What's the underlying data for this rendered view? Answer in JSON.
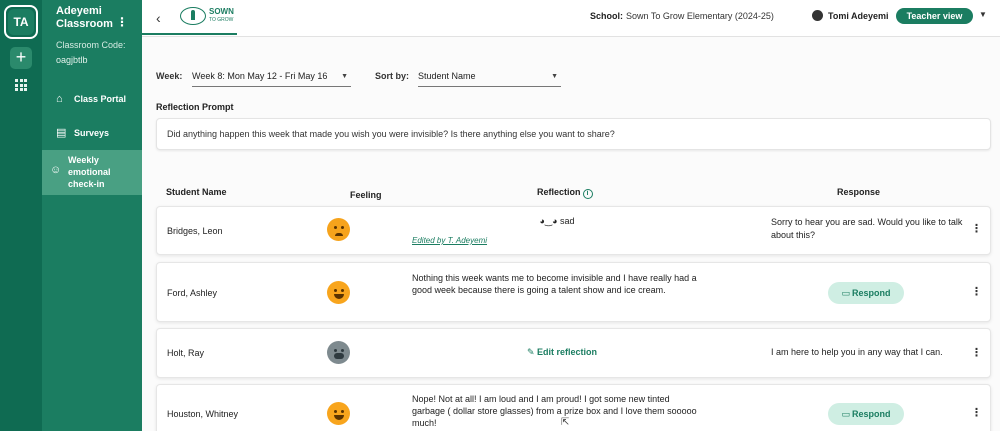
{
  "sidebar": {
    "avatar_initials": "TA",
    "add_symbol": "+",
    "classroom_name": "Adeyemi Classroom",
    "code_label": "Classroom Code:",
    "code_value": "oagjbtlb",
    "items": [
      {
        "label": "Class Portal",
        "icon": "home-icon"
      },
      {
        "label": "Surveys",
        "icon": "clipboard-icon"
      },
      {
        "label": "Weekly emotional check-in",
        "icon": "smiley-icon",
        "active": true
      }
    ]
  },
  "topbar": {
    "logo_text": "SOWN",
    "logo_subtext": "TO GROW",
    "school_label": "School:",
    "school_value": "Sown To Grow Elementary (2024-25)",
    "user_name": "Tomi Adeyemi",
    "view_button": "Teacher view"
  },
  "filters": {
    "week_label": "Week:",
    "week_value": "Week 8: Mon May 12 - Fri May 16",
    "sort_label": "Sort by:",
    "sort_value": "Student Name"
  },
  "prompt": {
    "label": "Reflection Prompt",
    "text": "Did anything happen this week that made you wish you were invisible? Is there anything else you want to share?"
  },
  "table": {
    "headers": {
      "name": "Student Name",
      "feeling": "Feeling",
      "reflection": "Reflection",
      "response": "Response"
    },
    "rows": [
      {
        "name": "Bridges, Leon",
        "feeling": "sad",
        "reflection": "◕‿◕ sad",
        "edited": "Edited by T. Adeyemi",
        "response": "Sorry to hear you are sad. Would you like to talk about this?"
      },
      {
        "name": "Ford, Ashley",
        "feeling": "happy",
        "reflection": "Nothing this week wants me to become invisible and I have really had a good week because there is going a talent show and ice cream.",
        "respond_label": "Respond"
      },
      {
        "name": "Holt, Ray",
        "feeling": "anxious",
        "edit_label": "Edit reflection",
        "response": "I am here to help you in any way that I can."
      },
      {
        "name": "Houston, Whitney",
        "feeling": "happy",
        "reflection": "Nope! Not at all! I am loud and I am proud! I got some new tinted garbage ( dollar store glasses) from a prize box and I love them sooooo much!",
        "respond_label": "Respond"
      }
    ]
  },
  "colors": {
    "brand": "#1b7d61",
    "rail": "#0f6b52",
    "active": "#49a083",
    "respond_bg": "#cfeee3"
  }
}
